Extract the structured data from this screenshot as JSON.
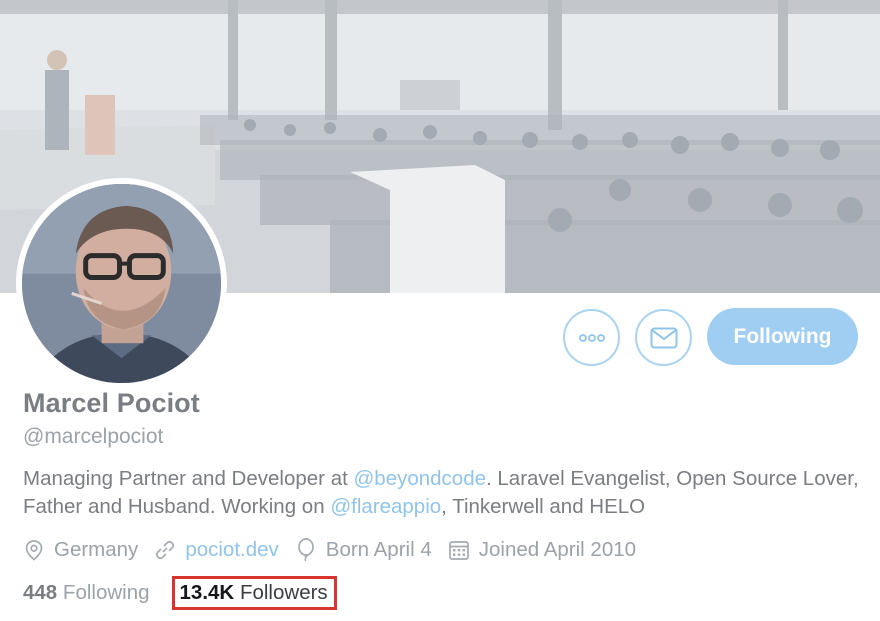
{
  "profile": {
    "name": "Marcel Pociot",
    "handle": "@marcelpociot",
    "bio": {
      "part1": "Managing Partner and Developer at ",
      "mention1": "@beyondcode",
      "part2": ". Laravel Evangelist, Open Source Lover, Father and Husband. Working on ",
      "mention2": "@flareappio",
      "part3": ", Tinkerwell and HELO"
    },
    "location": "Germany",
    "website": "pociot.dev",
    "birthday": "Born April 4",
    "joined": "Joined April 2010"
  },
  "actions": {
    "follow_label": "Following"
  },
  "stats": {
    "following_count": "448",
    "following_label": "Following",
    "followers_count": "13.4K",
    "followers_label": "Followers"
  },
  "icons": {
    "more": "more-icon",
    "mail": "mail-icon",
    "location": "location-pin-icon",
    "link": "link-icon",
    "birthday": "balloon-icon",
    "calendar": "calendar-icon"
  },
  "colors": {
    "accent": "#9fcef2",
    "link": "#8fc4ec",
    "highlight_box": "#d8362d"
  }
}
